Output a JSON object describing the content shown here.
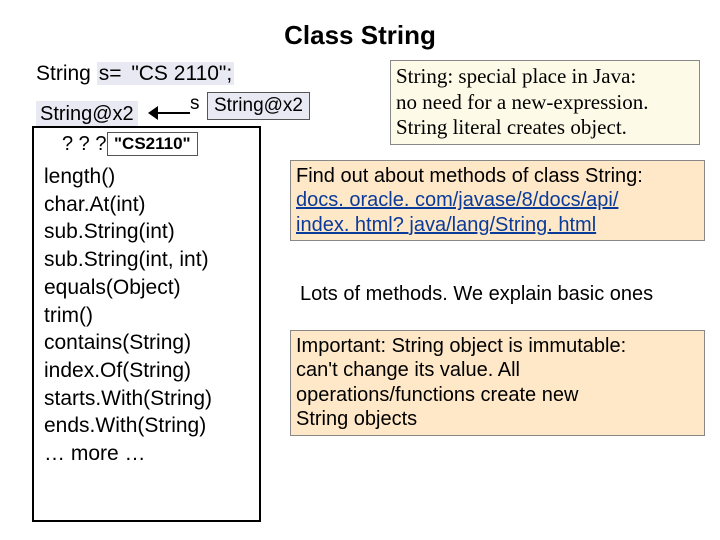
{
  "title": "Class String",
  "decl": {
    "prefix": "String ",
    "var": "s= ",
    "literal": "\"CS 2110\";"
  },
  "objLabel": "String@x2",
  "sLabel": "s",
  "sBox": "String@x2",
  "q": "? ? ?",
  "qBox": "\"CS2110\"",
  "methods": [
    "length()",
    "char.At(int)",
    "sub.String(int)",
    "sub.String(int, int)",
    "equals(Object)",
    "trim()",
    "contains(String)",
    "index.Of(String)",
    "starts.With(String)",
    "ends.With(String)",
    "…  more  …"
  ],
  "box1": {
    "l1": "String: special place in Java:",
    "l2": "no need for a new-expression.",
    "l3": "String literal creates object."
  },
  "box2": {
    "l1": "Find out about methods of class String:",
    "link1": "docs. oracle. com/javase/8/docs/api/",
    "link2": "index. html? java/lang/String. html"
  },
  "box3": "Lots of methods. We explain basic ones",
  "box4": {
    "l1": "Important: String object is immutable:",
    "l2": "can't change its value. All",
    "l3": "operations/functions create new",
    "l4": "String objects"
  }
}
